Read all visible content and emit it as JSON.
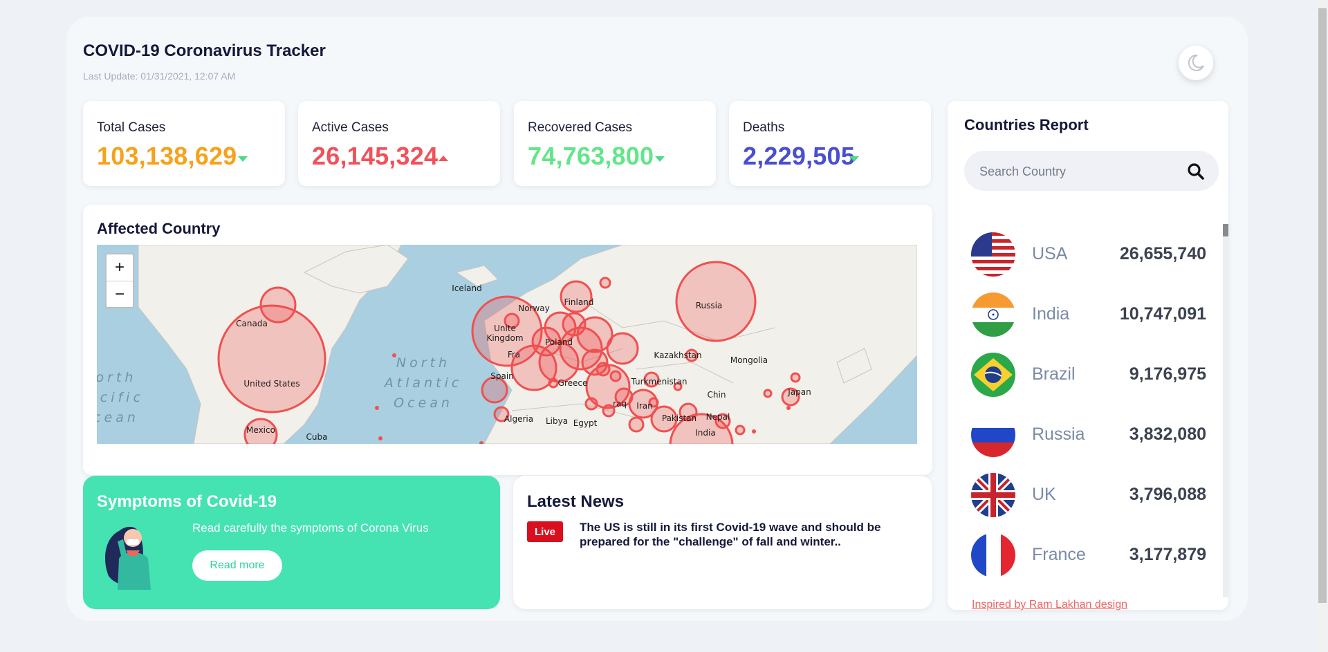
{
  "header": {
    "title": "COVID-19 Coronavirus Tracker",
    "last_update": "Last Update: 01/31/2021, 12:07 AM",
    "theme_icon": "moon-icon"
  },
  "stats": [
    {
      "label": "Total Cases",
      "value": "103,138,629",
      "color": "#f7a21b",
      "trend": "down"
    },
    {
      "label": "Active Cases",
      "value": "26,145,324",
      "color": "#f2515b",
      "trend": "up"
    },
    {
      "label": "Recovered Cases",
      "value": "74,763,800",
      "color": "#63e58a",
      "trend": "down"
    },
    {
      "label": "Deaths",
      "value": "2,229,505",
      "color": "#4a4fd0",
      "trend": "down"
    }
  ],
  "map": {
    "title": "Affected Country",
    "zoom_in": "+",
    "zoom_out": "−",
    "labels": {
      "canada": "Canada",
      "usa": "United States",
      "mexico": "Mexico",
      "cuba": "Cuba",
      "north_atlantic": [
        "North",
        "Atlantic",
        "Ocean"
      ],
      "north_pacific": [
        "orth",
        "acific",
        "cean"
      ],
      "iceland": "Iceland",
      "norway": "Norway",
      "finland": "Finland",
      "uk": [
        "Unite",
        "Kingdom"
      ],
      "poland": "Poland",
      "france": "Fra",
      "spain": "Spain",
      "greece": "Greece",
      "russia": "Russia",
      "kazakhstan": "Kazakhstan",
      "mongolia": "Mongolia",
      "turkmenistan": "Turkmenistan",
      "china": "Chin",
      "japan": "Japan",
      "iraq": "raq",
      "iran": "Iran",
      "pakistan": "Pakistan",
      "nepal": "Nepal",
      "india": "India",
      "algeria": "Algeria",
      "libya": "Libya",
      "egypt": "Egypt"
    }
  },
  "symptoms": {
    "title": "Symptoms of Covid-19",
    "description": "Read carefully the symptoms of Corona Virus",
    "button": "Read more"
  },
  "news": {
    "title": "Latest News",
    "badge": "Live",
    "text": "The US is still in its first Covid-19 wave and should be prepared for the \"challenge\" of fall and winter.."
  },
  "countries": {
    "title": "Countries Report",
    "search_placeholder": "Search Country",
    "items": [
      {
        "name": "USA",
        "count": "26,655,740"
      },
      {
        "name": "India",
        "count": "10,747,091"
      },
      {
        "name": "Brazil",
        "count": "9,176,975"
      },
      {
        "name": "Russia",
        "count": "3,832,080"
      },
      {
        "name": "UK",
        "count": "3,796,088"
      },
      {
        "name": "France",
        "count": "3,177,879"
      }
    ]
  },
  "credit": "Inspired by Ram Lakhan design"
}
